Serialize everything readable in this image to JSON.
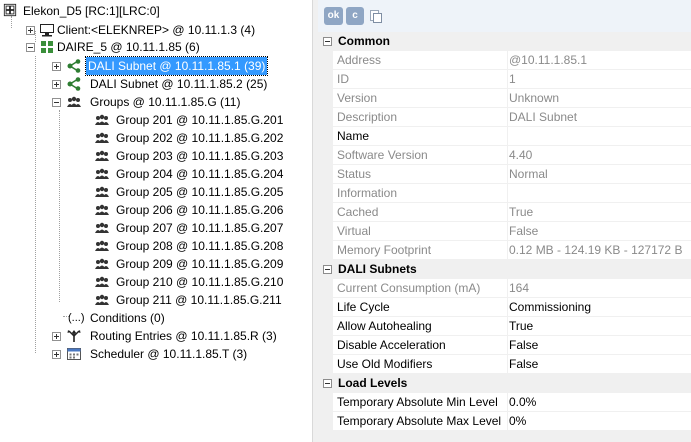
{
  "tree": {
    "root": "Elekon_D5 [RC:1][LRC:0]",
    "client": "Client:<ELEKNREP> @ 10.11.1.3 (4)",
    "daire": "DAIRE_5 @ 10.11.1.85 (6)",
    "subnet1": "DALI Subnet @ 10.11.1.85.1 (39)",
    "subnet2": "DALI Subnet @ 10.11.1.85.2 (25)",
    "groups": "Groups @ 10.11.1.85.G (11)",
    "group_items": [
      "Group 201 @ 10.11.1.85.G.201",
      "Group 202 @ 10.11.1.85.G.202",
      "Group 203 @ 10.11.1.85.G.203",
      "Group 204 @ 10.11.1.85.G.204",
      "Group 205 @ 10.11.1.85.G.205",
      "Group 206 @ 10.11.1.85.G.206",
      "Group 207 @ 10.11.1.85.G.207",
      "Group 208 @ 10.11.1.85.G.208",
      "Group 209 @ 10.11.1.85.G.209",
      "Group 210 @ 10.11.1.85.G.210",
      "Group 211 @ 10.11.1.85.G.211"
    ],
    "conditions_icon": "(...)",
    "conditions": "Conditions (0)",
    "routing": "Routing Entries @ 10.11.1.85.R (3)",
    "scheduler": "Scheduler @ 10.11.1.85.T (3)"
  },
  "toolbar": {
    "ok_label": "ok",
    "c_label": "c"
  },
  "properties": {
    "common": {
      "title": "Common",
      "rows": [
        {
          "name": "Address",
          "value": "@10.11.1.85.1"
        },
        {
          "name": "ID",
          "value": "1"
        },
        {
          "name": "Version",
          "value": "Unknown"
        },
        {
          "name": "Description",
          "value": "DALI Subnet"
        },
        {
          "name": "Name",
          "value": ""
        },
        {
          "name": "Software Version",
          "value": "4.40"
        },
        {
          "name": "Status",
          "value": "Normal"
        },
        {
          "name": "Information",
          "value": ""
        },
        {
          "name": "Cached",
          "value": "True"
        },
        {
          "name": "Virtual",
          "value": "False"
        },
        {
          "name": "Memory Footprint",
          "value": "0.12 MB - 124.19 KB - 127172 B"
        }
      ]
    },
    "dali": {
      "title": "DALI Subnets",
      "rows": [
        {
          "name": "Current Consumption (mA)",
          "value": "164"
        },
        {
          "name": "Life Cycle",
          "value": "Commissioning"
        },
        {
          "name": "Allow Autohealing",
          "value": "True"
        },
        {
          "name": "Disable Acceleration",
          "value": "False"
        },
        {
          "name": "Use Old Modifiers",
          "value": "False"
        }
      ]
    },
    "load": {
      "title": "Load Levels",
      "rows": [
        {
          "name": "Temporary Absolute Min Level",
          "value": "0.0%"
        },
        {
          "name": "Temporary Absolute Max Level",
          "value": "0%"
        }
      ]
    }
  }
}
